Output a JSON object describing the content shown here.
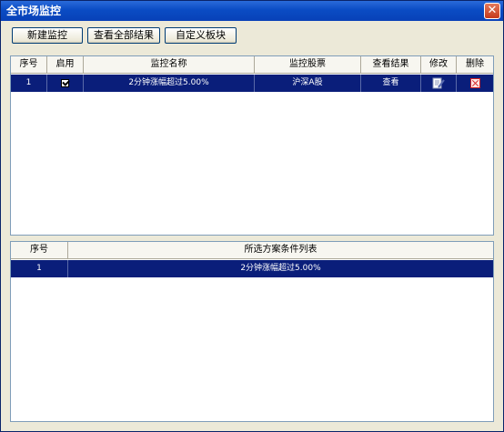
{
  "window": {
    "title": "全市场监控",
    "close_symbol": "✕"
  },
  "toolbar": {
    "new_label": "新建监控",
    "view_all_label": "查看全部结果",
    "custom_label": "自定义板块"
  },
  "monitor_table": {
    "headers": [
      "序号",
      "启用",
      "监控名称",
      "监控股票",
      "查看结果",
      "修改",
      "删除"
    ],
    "rows": [
      {
        "index": "1",
        "enabled": true,
        "name": "2分钟涨幅超过5.00%",
        "stocks": "沪深A股",
        "view": "查看"
      }
    ]
  },
  "condition_table": {
    "headers": [
      "序号",
      "所选方案条件列表"
    ],
    "rows": [
      {
        "index": "1",
        "condition": "2分钟涨幅超过5.00%"
      }
    ]
  },
  "colors": {
    "selection": "#0a1e7a",
    "titlebar": "#0a4cc4"
  }
}
